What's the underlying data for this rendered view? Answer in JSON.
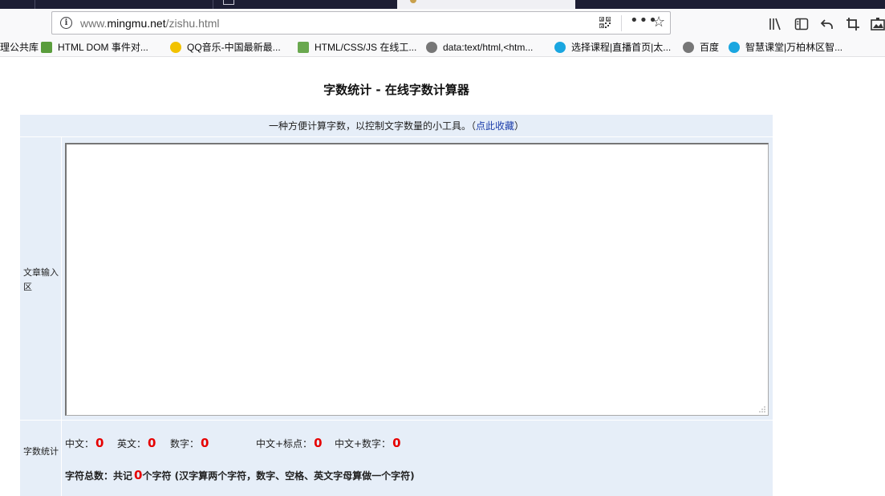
{
  "browser": {
    "url_prefix": "www.",
    "url_host": "mingmu.net",
    "url_path": "/zishu.html",
    "menu_dots": "•••"
  },
  "bookmarks": [
    {
      "label": "理公共库",
      "icon": "folder-icon",
      "color": "#ffffff"
    },
    {
      "label": "HTML DOM 事件对...",
      "icon": "w3school-icon",
      "color": "#5a9d3c"
    },
    {
      "label": "QQ音乐-中国最新最...",
      "icon": "qqmusic-icon",
      "color": "#f2c200"
    },
    {
      "label": "HTML/CSS/JS 在线工...",
      "icon": "runoob-icon",
      "color": "#6aa84f"
    },
    {
      "label": "data:text/html,<htm...",
      "icon": "globe-icon",
      "color": "#777777"
    },
    {
      "label": "选择课程|直播首页|太...",
      "icon": "cloud-icon",
      "color": "#1aa6e0"
    },
    {
      "label": "百度",
      "icon": "globe-icon",
      "color": "#777777"
    },
    {
      "label": "智慧课堂|万柏林区智...",
      "icon": "cloud-icon",
      "color": "#1aa6e0"
    }
  ],
  "page": {
    "title": "字数统计 - 在线字数计算器",
    "intro_text": "一种方便计算字数，以控制文字数量的小工具。",
    "intro_paren_open": "（",
    "intro_link": "点此收藏",
    "intro_paren_close": "）",
    "input_label": "文章输入区",
    "input_value": "",
    "stats_label": "字数统计"
  },
  "stats": {
    "chinese_label": "中文：",
    "chinese_value": "0",
    "english_label": "英文：",
    "english_value": "0",
    "digits_label": "数字：",
    "digits_value": "0",
    "cn_punct_label": "中文+标点：",
    "cn_punct_value": "0",
    "cn_digits_label": "中文+数字：",
    "cn_digits_value": "0",
    "total_prefix": "字符总数：共记",
    "total_value": "0",
    "total_suffix": "个字符 (汉字算两个字符，数字、空格、英文字母算做一个字符)"
  },
  "colors": {
    "panel_bg": "#e6eef8",
    "number_red": "#e60000",
    "link_blue": "#1a3caa",
    "tabstrip": "#1d1e34"
  }
}
